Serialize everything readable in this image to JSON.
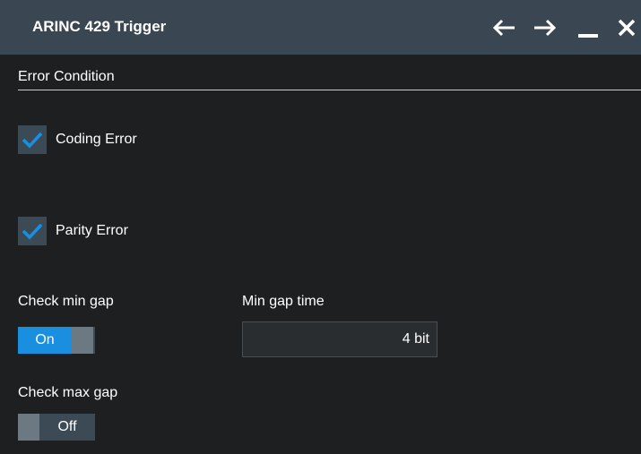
{
  "window": {
    "title": "ARINC 429 Trigger",
    "buttons": {
      "back_icon": "arrow-left-icon",
      "forward_icon": "arrow-right-icon",
      "minimize_icon": "minimize-icon",
      "close_icon": "close-icon"
    }
  },
  "section": {
    "title": "Error Condition"
  },
  "checkboxes": {
    "coding_error": {
      "label": "Coding Error",
      "checked": true
    },
    "parity_error": {
      "label": "Parity Error",
      "checked": true
    }
  },
  "min_gap": {
    "check_label": "Check min gap",
    "toggle_state": "On",
    "time_label": "Min gap time",
    "time_value": "4 bit"
  },
  "max_gap": {
    "check_label": "Check max gap",
    "toggle_state": "Off"
  },
  "colors": {
    "background": "#1d1f21",
    "titlebar": "#3a4651",
    "accent_blue": "#1a8fe0",
    "control_bg": "#3b4a55"
  }
}
